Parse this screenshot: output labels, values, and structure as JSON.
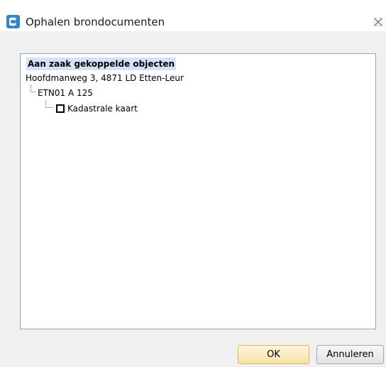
{
  "window": {
    "title": "Ophalen brondocumenten"
  },
  "tree": {
    "root_label": "Aan zaak gekoppelde objecten",
    "address": "Hoofdmanweg 3, 4871 LD Etten-Leur",
    "parcel": "ETN01 A 125",
    "document": "Kadastrale kaart",
    "document_checked": false
  },
  "buttons": {
    "ok_label": "OK",
    "cancel_label": "Annuleren"
  },
  "colors": {
    "selection_highlight": "#d4e3f7",
    "ok_border": "#e9b54a",
    "panel_border": "#9aa5b3"
  }
}
